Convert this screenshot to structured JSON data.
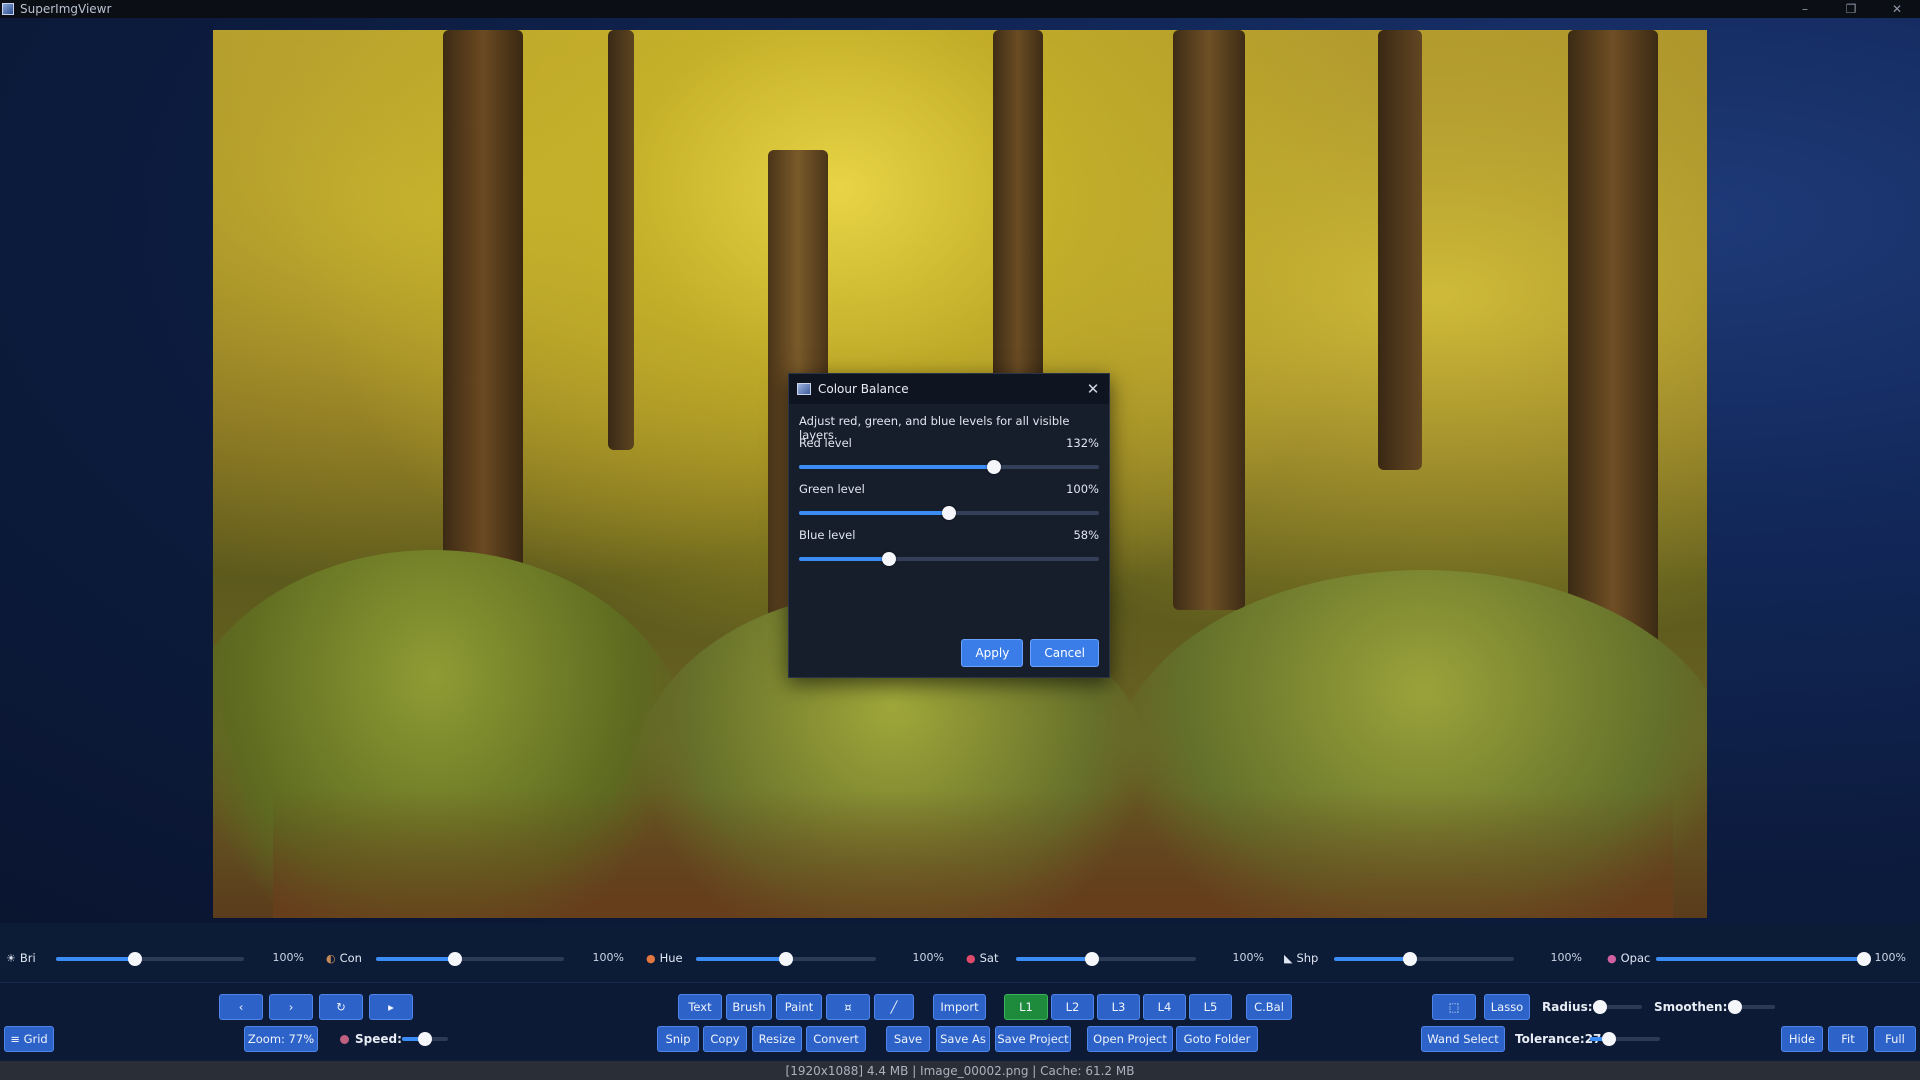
{
  "app": {
    "title": "SuperImgViewr"
  },
  "window_controls": {
    "minimize": "–",
    "restore": "❐",
    "close": "✕"
  },
  "dialog": {
    "title": "Colour Balance",
    "close_glyph": "✕",
    "description": "Adjust red, green, and blue levels for all visible layers.",
    "levels": [
      {
        "label": "Red level",
        "value_text": "132%",
        "fraction": 0.65
      },
      {
        "label": "Green level",
        "value_text": "100%",
        "fraction": 0.5
      },
      {
        "label": "Blue level",
        "value_text": "58%",
        "fraction": 0.3
      }
    ],
    "apply_label": "Apply",
    "cancel_label": "Cancel"
  },
  "adjustments": [
    {
      "icon": "sun-icon",
      "glyph": "☀",
      "label": "Bri",
      "value_text": "100%",
      "fraction": 0.42
    },
    {
      "icon": "contrast-icon",
      "glyph": "◐",
      "label": "Con",
      "value_text": "100%",
      "fraction": 0.42
    },
    {
      "icon": "hue-icon",
      "glyph": "●",
      "label": "Hue",
      "value_text": "100%",
      "fraction": 0.5
    },
    {
      "icon": "saturation-icon",
      "glyph": "●",
      "label": "Sat",
      "value_text": "100%",
      "fraction": 0.42
    },
    {
      "icon": "sharpness-icon",
      "glyph": "◣",
      "label": "Shp",
      "value_text": "100%",
      "fraction": 0.42
    },
    {
      "icon": "opacity-icon",
      "glyph": "●",
      "label": "Opac",
      "value_text": "100%",
      "fraction": 1.0
    }
  ],
  "toolbar": {
    "nav": {
      "prev": "‹",
      "next": "›",
      "rotate": "↻",
      "play": "▸"
    },
    "tools": {
      "text": "Text",
      "brush": "Brush",
      "paint": "Paint",
      "eraser": "¤",
      "line": "╱",
      "import": "Import"
    },
    "layers": [
      "L1",
      "L2",
      "L3",
      "L4",
      "L5"
    ],
    "colour_balance": "C.Bal",
    "select_rect": "⬚",
    "lasso": "Lasso",
    "radius_label": "Radius:0",
    "radius_fraction": 0.0,
    "smoothen_label": "Smoothen:0",
    "smoothen_fraction": 0.0,
    "grid": "≡ Grid",
    "zoom": "Zoom: 77%",
    "speed_label": "Speed:",
    "speed_fraction": 0.5,
    "snip": "Snip",
    "copy": "Copy",
    "resize": "Resize",
    "convert": "Convert",
    "save": "Save",
    "save_as": "Save As",
    "save_project": "Save Project",
    "open_project": "Open Project",
    "goto_folder": "Goto Folder",
    "wand_select": "Wand Select",
    "tolerance_label": "Tolerance:27",
    "tolerance_fraction": 0.27,
    "hide": "Hide",
    "fit": "Fit",
    "full": "Full"
  },
  "status": {
    "text": "[1920x1088] 4.4 MB | Image_00002.png | Cache: 61.2 MB"
  },
  "colors": {
    "accent": "#3c8cf5",
    "button": "#2d63c9",
    "active_layer": "#1e8a3c",
    "background": "#0c1b36"
  }
}
